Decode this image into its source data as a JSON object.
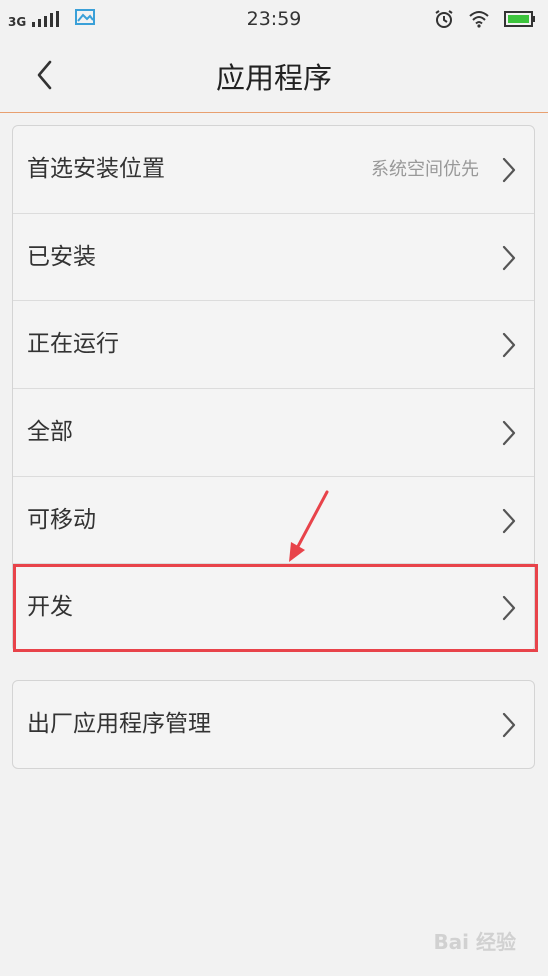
{
  "status_bar": {
    "network": "3G",
    "time": "23:59",
    "icons": [
      "signal-icon",
      "image-icon",
      "alarm-icon",
      "wifi-icon",
      "battery-icon"
    ]
  },
  "header": {
    "title": "应用程序",
    "back_icon": "chevron-left-icon"
  },
  "list": {
    "items": [
      {
        "label": "首选安装位置",
        "value": "系统空间优先"
      },
      {
        "label": "已安装"
      },
      {
        "label": "正在运行"
      },
      {
        "label": "全部"
      },
      {
        "label": "可移动"
      },
      {
        "label": "开发"
      }
    ]
  },
  "list2": {
    "items": [
      {
        "label": "出厂应用程序管理"
      }
    ]
  },
  "annotation": {
    "highlight_color": "#e8434a",
    "highlighted_item": "开发"
  },
  "watermark": {
    "text": "Bai 经验"
  },
  "colors": {
    "background": "#f2f2f2",
    "header_divider": "#e8a070",
    "battery": "#3cc43c"
  }
}
